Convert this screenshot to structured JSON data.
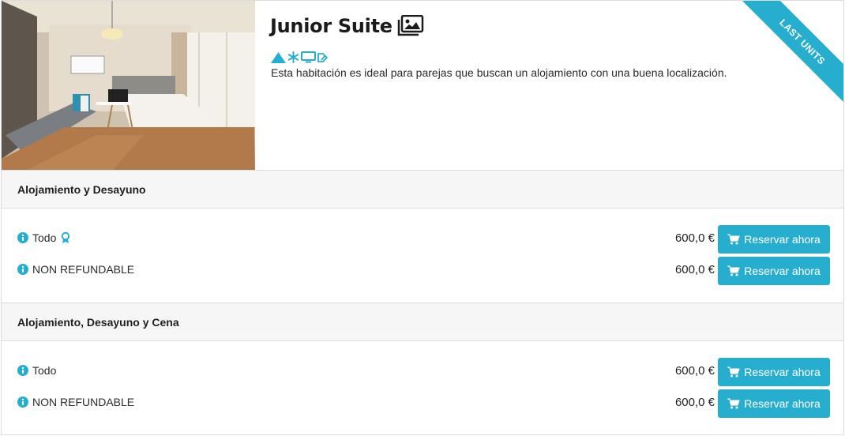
{
  "room": {
    "name": "Junior Suite",
    "description": "Esta habitación es ideal para parejas que buscan un alojamiento con una buena localización.",
    "ribbon": "LAST UNITS",
    "amenities": [
      "mountain-icon",
      "snowflake-icon",
      "tv-icon",
      "tag-icon"
    ],
    "accent_color": "#27aece"
  },
  "boards": [
    {
      "title": "Alojamiento y Desayuno",
      "rates": [
        {
          "name": "Todo",
          "has_award": true,
          "price": "600,0 €",
          "button": "Reservar ahora"
        },
        {
          "name": "NON REFUNDABLE",
          "has_award": false,
          "price": "600,0 €",
          "button": "Reservar ahora"
        }
      ]
    },
    {
      "title": "Alojamiento, Desayuno y Cena",
      "rates": [
        {
          "name": "Todo",
          "has_award": false,
          "price": "600,0 €",
          "button": "Reservar ahora"
        },
        {
          "name": "NON REFUNDABLE",
          "has_award": false,
          "price": "600,0 €",
          "button": "Reservar ahora"
        }
      ]
    }
  ]
}
